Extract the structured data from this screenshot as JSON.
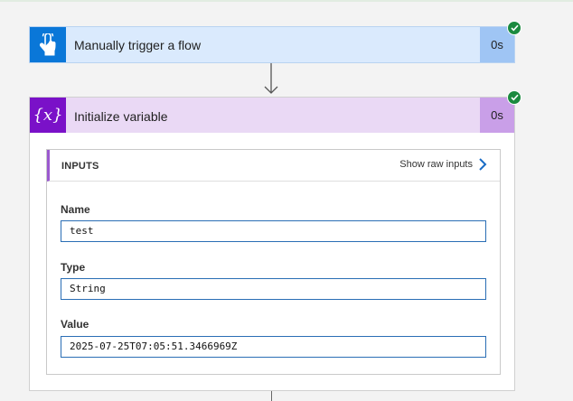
{
  "trigger_card": {
    "title": "Manually trigger a flow",
    "duration": "0s",
    "accent_color": "#0a77d8",
    "header_color": "#daeafd",
    "status": "succeeded",
    "icon": "touch-hand-icon"
  },
  "variable_card": {
    "title": "Initialize variable",
    "duration": "0s",
    "accent_color": "#7a11c8",
    "header_color": "#ead9f5",
    "status": "succeeded",
    "icon": "variable-icon",
    "icon_glyph": "{𝑥}",
    "inputs_panel": {
      "heading": "INPUTS",
      "show_raw_label": "Show raw inputs",
      "fields": [
        {
          "label": "Name",
          "value": "test"
        },
        {
          "label": "Type",
          "value": "String"
        },
        {
          "label": "Value",
          "value": "2025-07-25T07:05:51.3466969Z"
        }
      ]
    }
  },
  "colors": {
    "success_green": "#1b8a3f",
    "field_border": "#2a6eb5",
    "canvas": "#f3f3f3"
  }
}
